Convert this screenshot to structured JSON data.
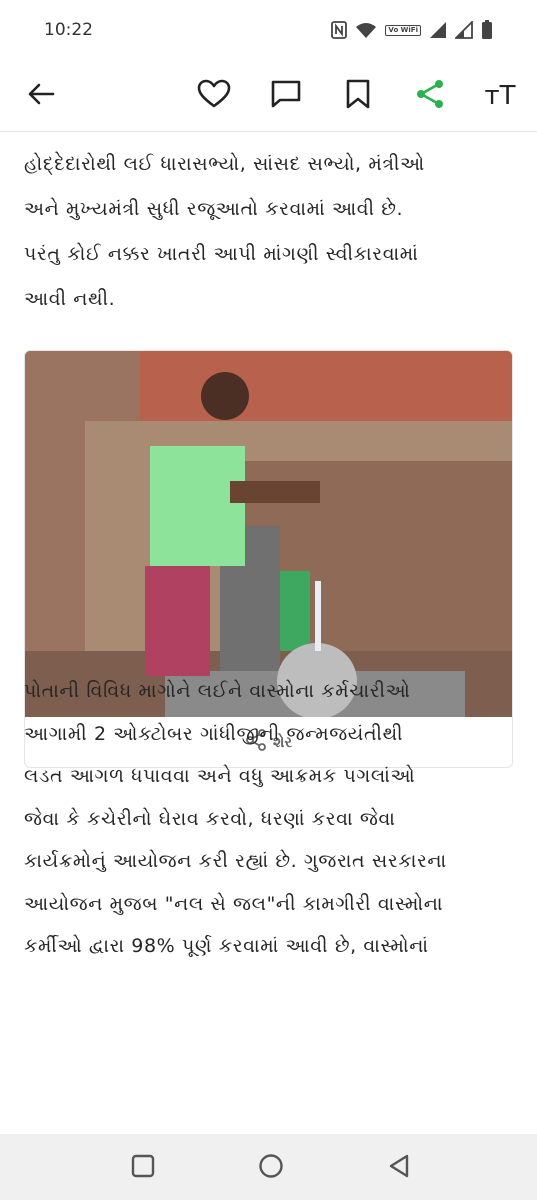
{
  "status_bar": {
    "time": "10:22",
    "vowifi_label": "Vo WiFi",
    "icons": [
      "nfc-icon",
      "wifi-icon",
      "vowifi-icon",
      "signal-icon",
      "signal-icon",
      "battery-icon"
    ]
  },
  "toolbar": {
    "back_icon": "arrow-left-icon",
    "like_icon": "heart-icon",
    "comment_icon": "comment-icon",
    "bookmark_icon": "bookmark-icon",
    "share_icon": "share-icon",
    "text_size_label": "тT",
    "accent_color": "#2bb24c"
  },
  "article": {
    "paragraph1_lines": [
      "હોદ્દેદારોથી લઈ ધારાસભ્યો, સાંસદ સભ્યો, મંત્રીઓ",
      "અને મુખ્યમંત્રી સુધી રજૂઆતો કરવામાં આવી છે.",
      "પરંતુ કોઈ નક્કર ખાતરી આપી માંગણી સ્વીકારવામાં",
      "આવી નથી."
    ],
    "image": {
      "share_label": "શેર",
      "share_icon": "share-icon"
    },
    "paragraph2_lines": [
      "પોતાની વિવિધ માગોને લઈને વાસ્મોના કર્મચારીઓ",
      "આગામી 2 ઓક્ટોબર ગાંધીજીની જન્મજયંતીથી",
      "લડત આગળ ધપાવવા અને વધુ આક્રમક પગલાંઓ",
      "જેવા કે કચેરીનો ઘેરાવ કરવો, ધરણાં કરવા જેવા",
      "કાર્યક્રમોનું આયોજન કરી રહ્યાં છે. ગુજરાત સરકારના",
      "આયોજન મુજબ \"નલ સે જલ\"ની કામગીરી વાસ્મોના",
      "કર્મીઓ દ્વારા 98% પૂર્ણ કરવામાં આવી છે, વાસ્મોનાં"
    ]
  },
  "nav_bar": {
    "icons": [
      "recents-square-icon",
      "home-circle-icon",
      "back-triangle-icon"
    ]
  }
}
